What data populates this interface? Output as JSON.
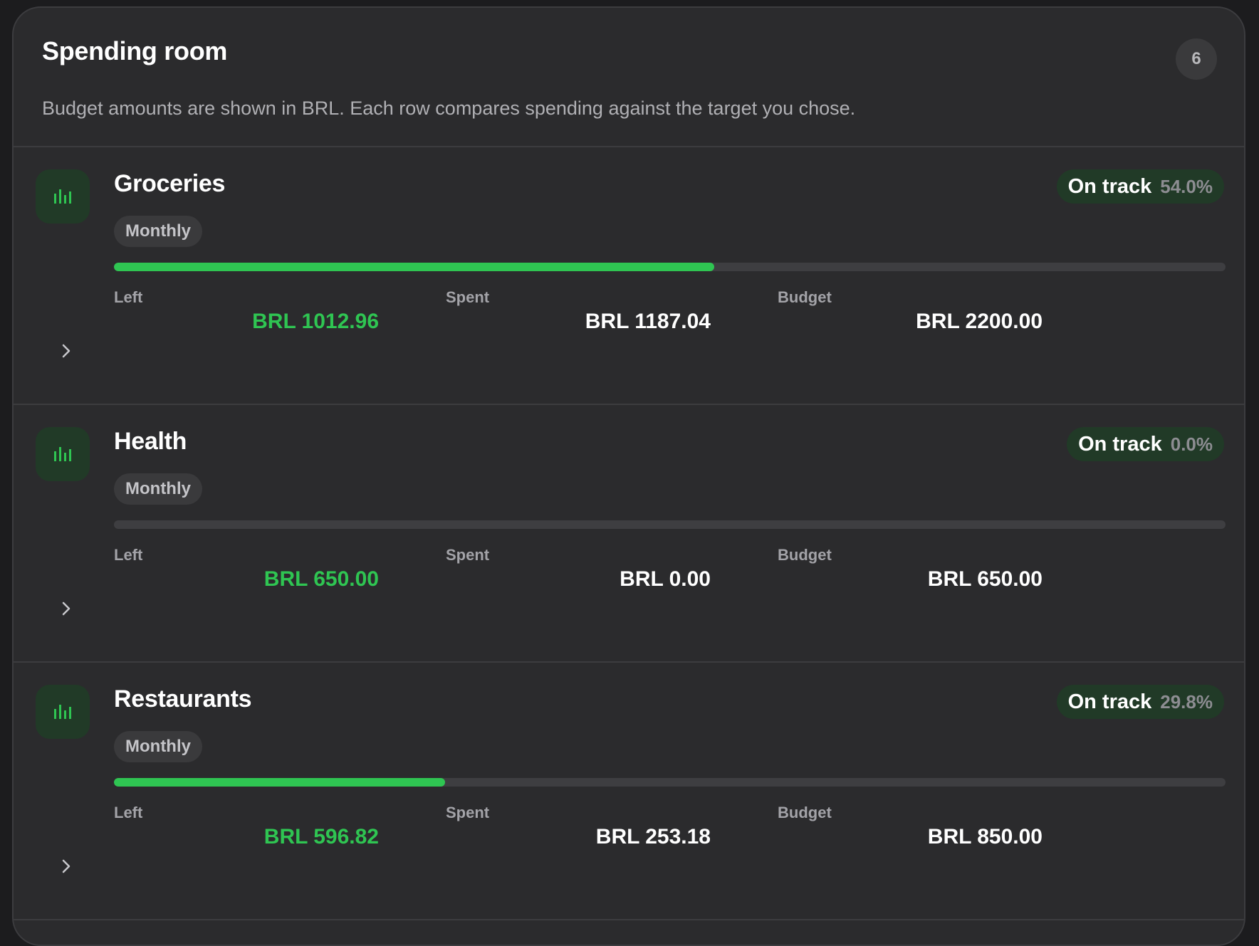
{
  "header": {
    "title": "Spending room",
    "count": "6",
    "subtitle": "Budget amounts are shown in BRL. Each row compares spending against the target you chose."
  },
  "colors": {
    "accent_green": "#2fc552",
    "card_background": "#2b2b2d",
    "icon_background": "#213a27"
  },
  "budgets": [
    {
      "icon": "bar-chart-icon",
      "name": "Groceries",
      "period": "Monthly",
      "status": "On track",
      "percent": "54.0%",
      "progress": 0.54,
      "left_label": "Left",
      "left_value": "BRL 1012.96",
      "spent_label": "Spent",
      "spent_value": "BRL 1187.04",
      "budget_label": "Budget",
      "budget_value": "BRL 2200.00"
    },
    {
      "icon": "bar-chart-icon",
      "name": "Health",
      "period": "Monthly",
      "status": "On track",
      "percent": "0.0%",
      "progress": 0.0,
      "left_label": "Left",
      "left_value": "BRL 650.00",
      "spent_label": "Spent",
      "spent_value": "BRL 0.00",
      "budget_label": "Budget",
      "budget_value": "BRL 650.00"
    },
    {
      "icon": "bar-chart-icon",
      "name": "Restaurants",
      "period": "Monthly",
      "status": "On track",
      "percent": "29.8%",
      "progress": 0.298,
      "left_label": "Left",
      "left_value": "BRL 596.82",
      "spent_label": "Spent",
      "spent_value": "BRL 253.18",
      "budget_label": "Budget",
      "budget_value": "BRL 850.00"
    }
  ]
}
